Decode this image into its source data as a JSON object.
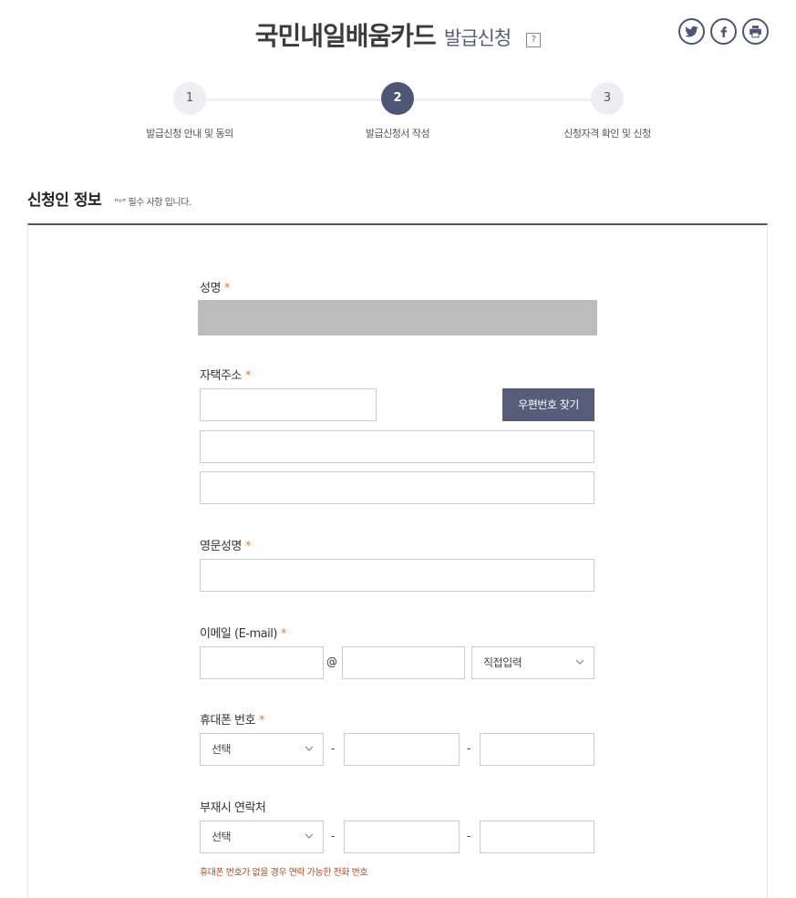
{
  "header": {
    "title_main": "국민내일배움카드",
    "title_sub": "발급신청",
    "help_symbol": "?"
  },
  "share": {
    "twitter_icon": "twitter-icon",
    "facebook_icon": "facebook-icon",
    "print_icon": "print-icon"
  },
  "steps": [
    {
      "number": "1",
      "label": "발급신청 안내 및 동의",
      "active": false
    },
    {
      "number": "2",
      "label": "발급신청서 작성",
      "active": true
    },
    {
      "number": "3",
      "label": "신청자격 확인 및 신청",
      "active": false
    }
  ],
  "section": {
    "title": "신청인 정보",
    "note_prefix": "\"",
    "note_star": "*",
    "note_suffix": "\" 필수 사항 입니다."
  },
  "form": {
    "required_mark": "*",
    "name": {
      "label": "성명",
      "value": ""
    },
    "address": {
      "label": "자택주소",
      "zip_button": "우편번호 찾기",
      "zip_value": "",
      "line1_value": "",
      "line2_value": ""
    },
    "english_name": {
      "label": "영문성명",
      "value": ""
    },
    "email": {
      "label": "이메일 (E-mail)",
      "at": "@",
      "domain_select": "직접입력"
    },
    "mobile": {
      "label": "휴대폰 번호",
      "prefix_select": "선택",
      "dash": "-"
    },
    "alt_phone": {
      "label": "부재시 연락처",
      "prefix_select": "선택",
      "dash": "-",
      "hint": "휴대폰 번호가 없을 경우 연락 가능한 전화 번호"
    }
  },
  "colors": {
    "accent": "#4f5575",
    "required": "#e07a3c",
    "hint": "#a0522d"
  }
}
